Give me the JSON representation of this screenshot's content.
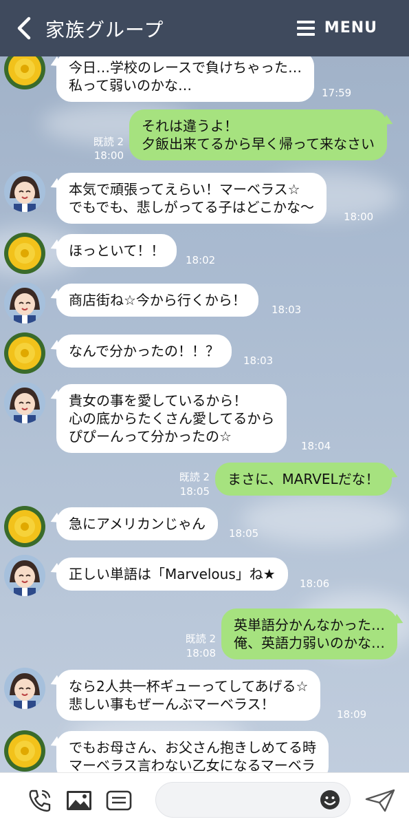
{
  "header": {
    "title": "家族グループ",
    "menu_label": "MENU"
  },
  "messages": [
    {
      "text": "今日…学校のレースで負けちゃった…\n私って弱いのかな…",
      "time": "17:59"
    },
    {
      "text": "それは違うよ！\n夕飯出来てるから早く帰って来なさい",
      "read": "既読 2",
      "time": "18:00"
    },
    {
      "text": "本気で頑張ってえらい！マーベラス☆\nでもでも、悲しがってる子はどこかな〜",
      "time": "18:00"
    },
    {
      "text": "ほっといて！！",
      "time": "18:02"
    },
    {
      "text": "商店街ね☆今から行くから！",
      "time": "18:03"
    },
    {
      "text": "なんで分かったの！！？",
      "time": "18:03"
    },
    {
      "text": "貴女の事を愛しているから！\n心の底からたくさん愛してるから\nぴぴーんって分かったの☆",
      "time": "18:04"
    },
    {
      "text": "まさに、MARVELだな！",
      "read": "既読 2",
      "time": "18:05"
    },
    {
      "text": "急にアメリカンじゃん",
      "time": "18:05"
    },
    {
      "text": "正しい単語は「Marvelous」ね★",
      "time": "18:06"
    },
    {
      "text": "英単語分かんなかった…\n俺、英語力弱いのかな…",
      "read": "既読 2",
      "time": "18:08"
    },
    {
      "text": "なら2人共一杯ギューってしてあげる☆\n悲しい事もぜーんぶマーベラス！",
      "time": "18:09"
    },
    {
      "text": "でもお母さん、お父さん抱きしめてる時\nマーベラス言わない乙女になるマーベラ"
    }
  ],
  "icons": {
    "back": "chevron-left-icon",
    "menu": "hamburger-icon",
    "call": "phone-icon",
    "image": "image-icon",
    "keep": "list-icon",
    "emoji": "smiley-icon",
    "send": "paper-plane-icon"
  },
  "colors": {
    "header_bg": "#3f4a5d",
    "out_bubble": "#a6e27f",
    "in_bubble": "#ffffff"
  }
}
